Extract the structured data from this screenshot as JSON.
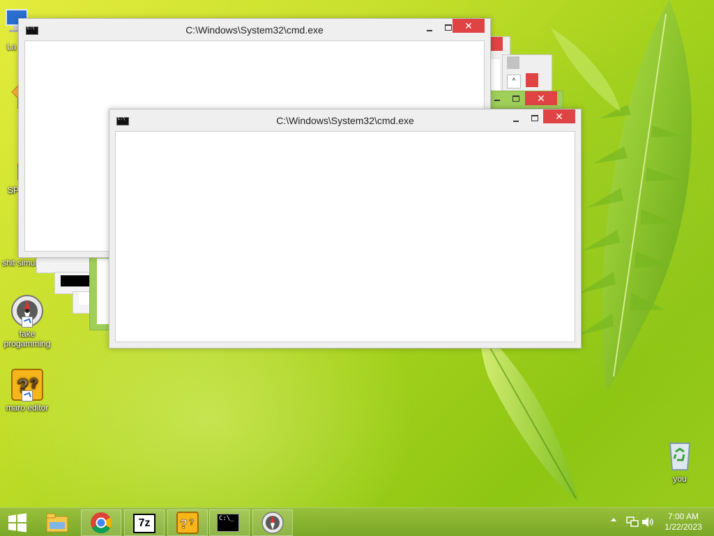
{
  "desktop": {
    "icons": [
      {
        "label": "La",
        "icon": "computer-icon"
      },
      {
        "label": "",
        "icon": "app-icon"
      },
      {
        "label": "SP",
        "icon": "chrome-icon"
      },
      {
        "label": "shit simul",
        "icon": "pink-app-icon"
      },
      {
        "label": "fake progamming",
        "icon": "compass-icon"
      },
      {
        "label": "maro editor",
        "icon": "question-block-icon"
      },
      {
        "label": "you",
        "icon": "recycle-bin-icon"
      }
    ]
  },
  "windows": {
    "back": {
      "title": "C:\\Windows\\System32\\cmd.exe",
      "close": "✕"
    },
    "front": {
      "title": "C:\\Windows\\System32\\cmd.exe",
      "close": "✕"
    },
    "ghost_close": "✕"
  },
  "taskbar": {
    "start_icon": "windows-logo-icon",
    "pinned": [
      "file-explorer-icon",
      "chrome-icon",
      "7zip-icon",
      "question-block-icon",
      "cmd-icon",
      "compass-icon"
    ],
    "seven_zip_label": "7z",
    "cmd_label": "C:\\_"
  },
  "tray": {
    "time": "7:00 AM",
    "date": "1/22/2023",
    "icons": [
      "show-hidden-icons-arrow",
      "network-icon",
      "volume-icon"
    ]
  },
  "colors": {
    "close_button": "#e04343",
    "accent": "#8ec614"
  }
}
